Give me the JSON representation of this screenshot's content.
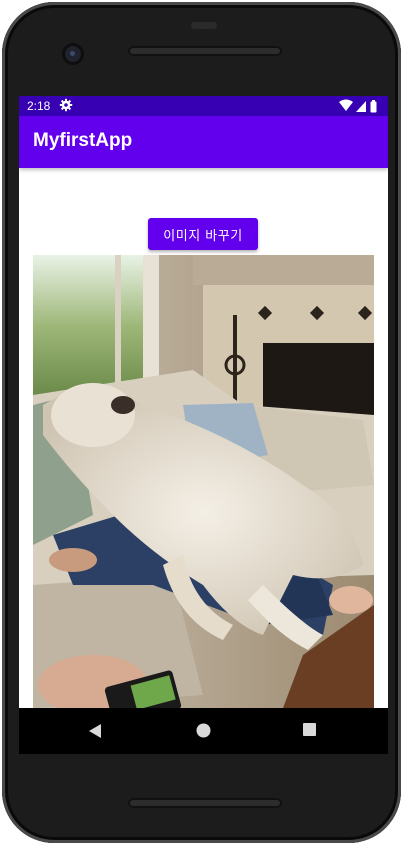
{
  "status_bar": {
    "time": "2:18",
    "icons": [
      "settings-icon",
      "wifi-icon",
      "signal-icon",
      "battery-icon"
    ]
  },
  "app_bar": {
    "title": "MyfirstApp",
    "color": "#6200ee"
  },
  "main": {
    "button_label": "이미지 바꾸기",
    "image_subject": "fluffy dog lying on a person on a couch"
  },
  "nav_bar": {
    "icons": [
      "back-icon",
      "home-icon",
      "recents-icon"
    ]
  },
  "colors": {
    "primary": "#6200ee",
    "primary_dark": "#3700b3"
  }
}
